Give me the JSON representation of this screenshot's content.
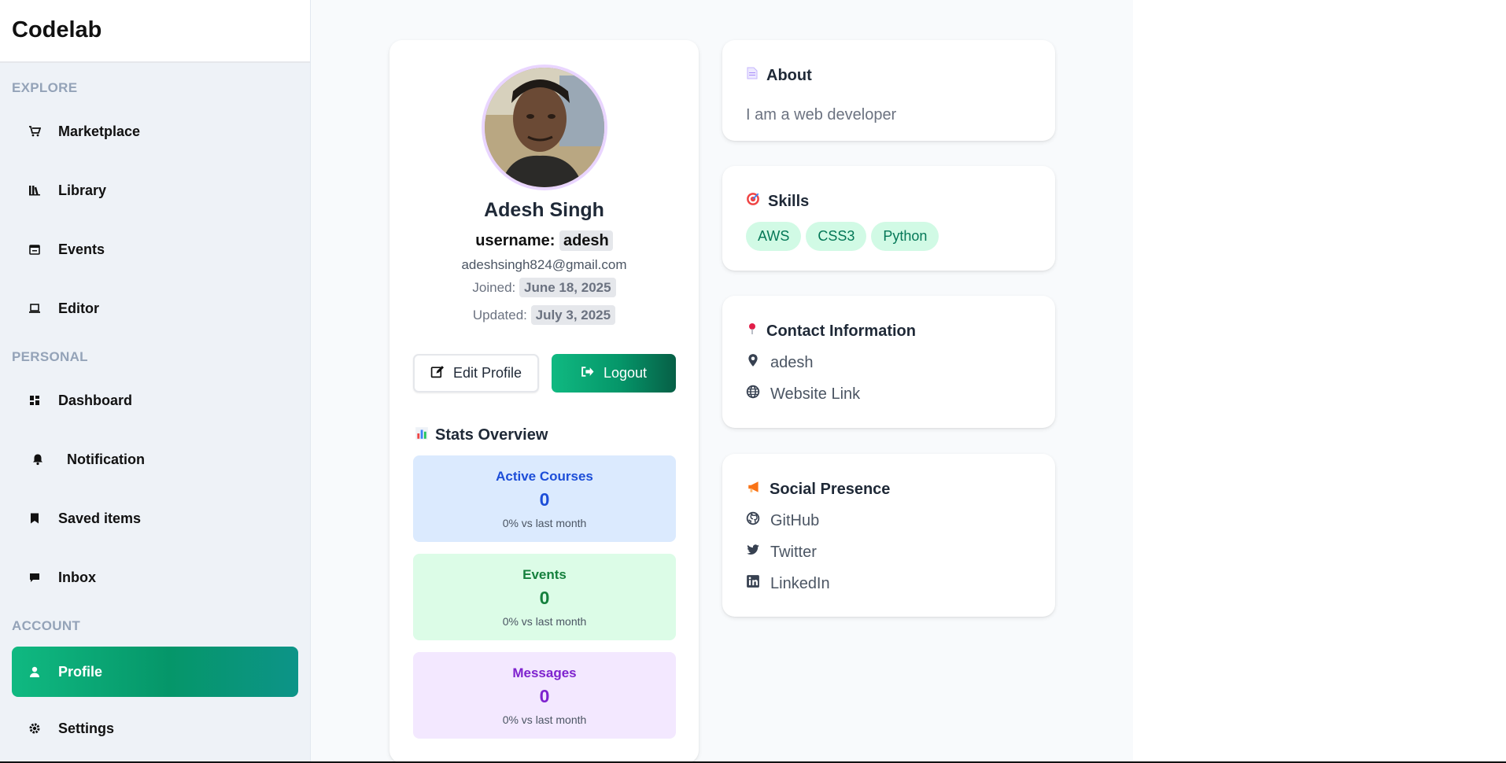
{
  "brand": "Codelab",
  "sidebar": {
    "sections": [
      {
        "label": "EXPLORE"
      },
      {
        "label": "PERSONAL"
      },
      {
        "label": "ACCOUNT"
      }
    ],
    "items": [
      {
        "label": "Marketplace",
        "icon": "cart-icon"
      },
      {
        "label": "Library",
        "icon": "library-icon"
      },
      {
        "label": "Events",
        "icon": "calendar-icon"
      },
      {
        "label": "Editor",
        "icon": "laptop-icon"
      },
      {
        "label": "Dashboard",
        "icon": "dashboard-icon"
      },
      {
        "label": "Notification",
        "icon": "bell-icon"
      },
      {
        "label": "Saved items",
        "icon": "bookmark-icon"
      },
      {
        "label": "Inbox",
        "icon": "chat-icon"
      },
      {
        "label": "Profile",
        "icon": "user-icon",
        "active": true
      },
      {
        "label": "Settings",
        "icon": "gear-icon"
      }
    ]
  },
  "profile": {
    "name": "Adesh Singh",
    "username_label": "username:",
    "username": "adesh",
    "email": "adeshsingh824@gmail.com",
    "joined_label": "Joined:",
    "joined": "June 18, 2025",
    "updated_label": "Updated:",
    "updated": "July 3, 2025",
    "edit_button": "Edit Profile",
    "logout_button": "Logout"
  },
  "stats": {
    "title": "Stats Overview",
    "items": [
      {
        "label": "Active Courses",
        "value": "0",
        "sub": "0% vs last month"
      },
      {
        "label": "Events",
        "value": "0",
        "sub": "0% vs last month"
      },
      {
        "label": "Messages",
        "value": "0",
        "sub": "0% vs last month"
      }
    ]
  },
  "about": {
    "title": "About",
    "text": "I am a web developer"
  },
  "skills": {
    "title": "Skills",
    "items": [
      "AWS",
      "CSS3",
      "Python"
    ]
  },
  "contact": {
    "title": "Contact Information",
    "location": "adesh",
    "website": "Website Link"
  },
  "social": {
    "title": "Social Presence",
    "github": "GitHub",
    "twitter": "Twitter",
    "linkedin": "LinkedIn"
  },
  "colors": {
    "accent": "#10b981",
    "accent_dark": "#065f46",
    "sidebar_bg": "#eef2f7",
    "main_bg": "#f8fafc"
  }
}
